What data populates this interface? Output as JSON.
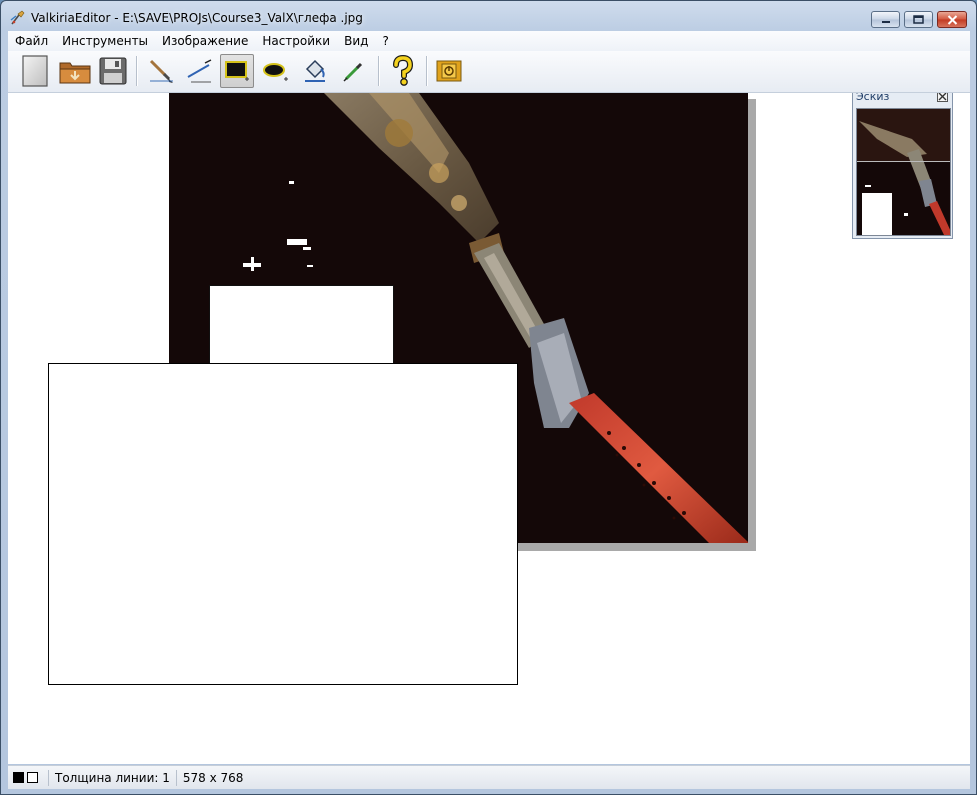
{
  "window": {
    "title": "ValkiriaEditor - E:\\SAVE\\PROJs\\Course3_ValX\\глефа .jpg"
  },
  "menu": {
    "items": [
      "Файл",
      "Инструменты",
      "Изображение",
      "Настройки",
      "Вид",
      "?"
    ]
  },
  "toolbar": {
    "buttons": [
      {
        "name": "new-document-icon"
      },
      {
        "name": "open-folder-icon"
      },
      {
        "name": "save-disk-icon"
      },
      {
        "name": "brush-icon"
      },
      {
        "name": "line-icon"
      },
      {
        "name": "rectangle-icon",
        "active": true
      },
      {
        "name": "ellipse-icon"
      },
      {
        "name": "fill-bucket-icon"
      },
      {
        "name": "eyedropper-icon"
      },
      {
        "name": "help-icon"
      },
      {
        "name": "exit-icon"
      }
    ]
  },
  "thumbnail": {
    "title": "Эскиз"
  },
  "status": {
    "line_thickness": "Толщина линии: 1",
    "image_size": "578 x 768"
  },
  "colors": {
    "foreground": "#000000",
    "background": "#ffffff",
    "canvas_bg": "#140808",
    "workspace_bg": "#ffffff"
  }
}
